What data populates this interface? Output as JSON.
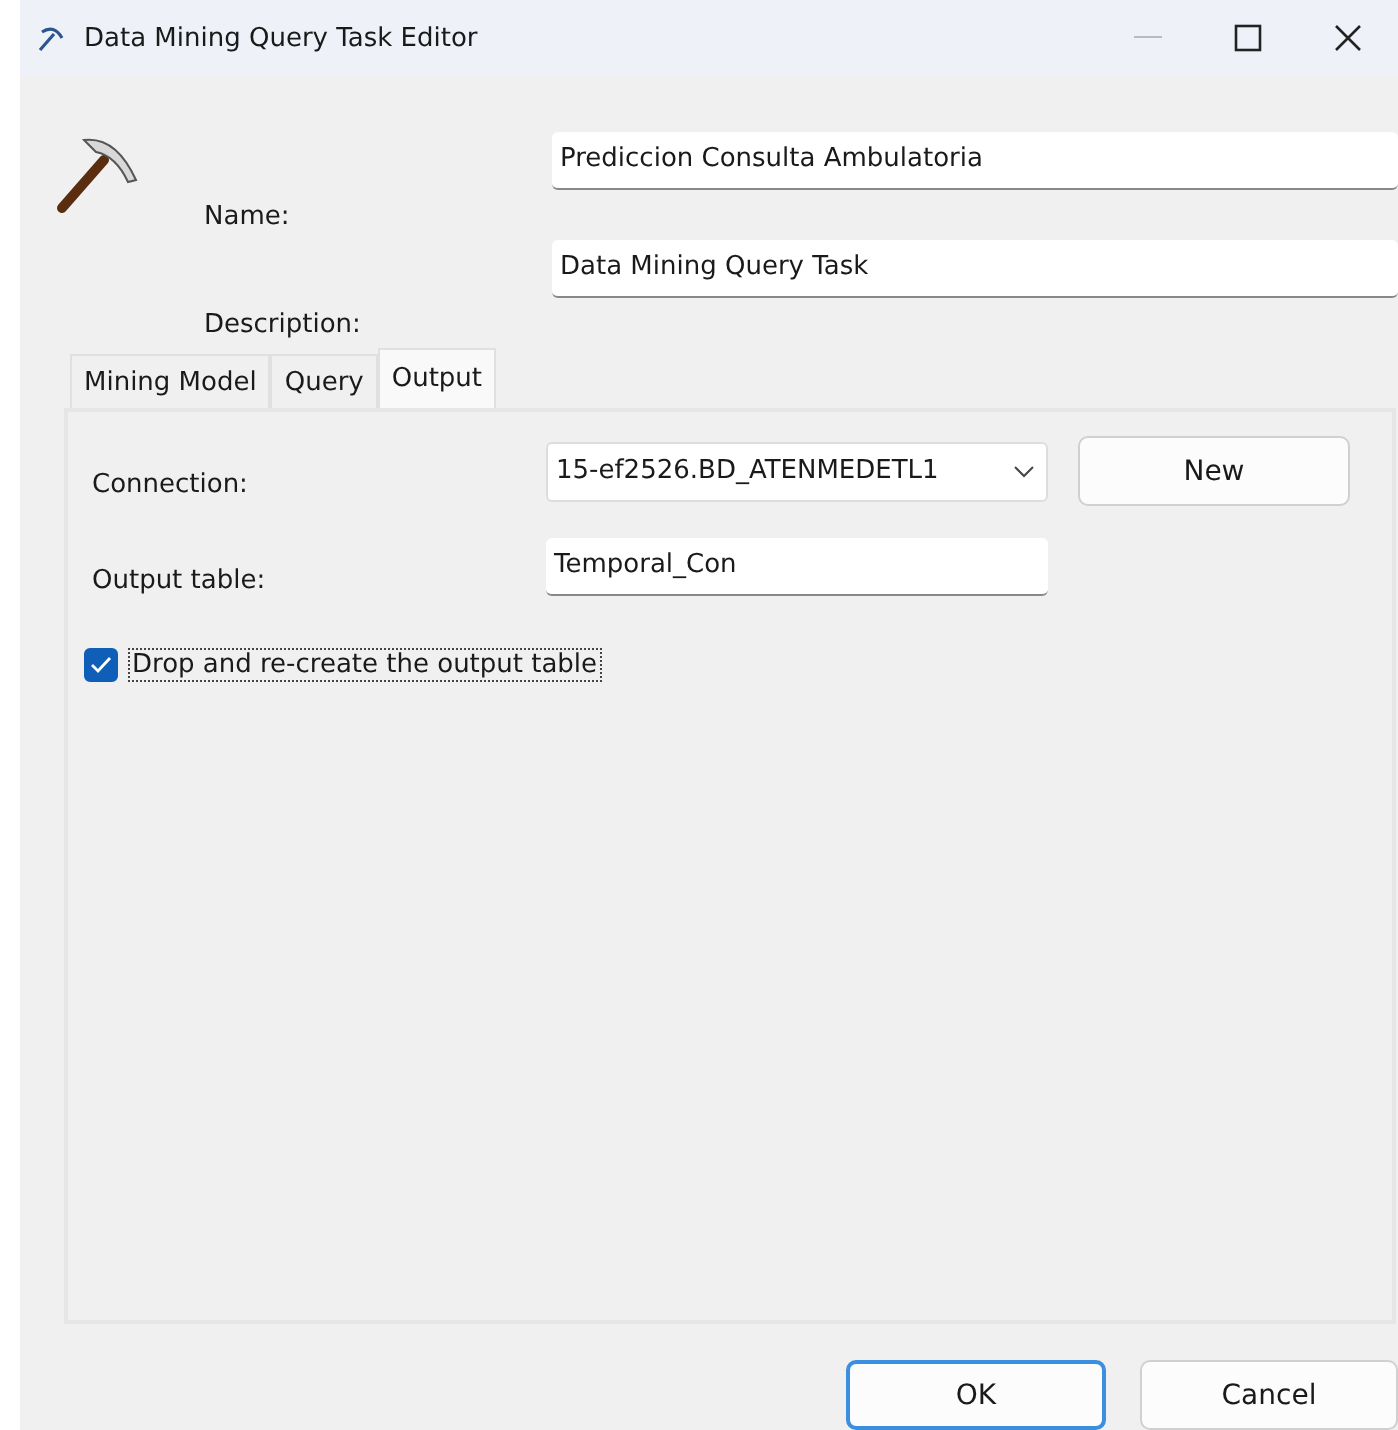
{
  "window": {
    "title": "Data Mining Query Task Editor"
  },
  "fields": [
    {
      "label": "Name:",
      "value": "Prediccion Consulta Ambulatoria"
    },
    {
      "label": "Description:",
      "value": "Data Mining Query Task"
    }
  ],
  "tabs": [
    {
      "label": "Mining Model",
      "selected": false
    },
    {
      "label": "Query",
      "selected": false
    },
    {
      "label": "Output",
      "selected": true
    }
  ],
  "output": {
    "connection": {
      "label": "Connection:",
      "value": "15-ef2526.BD_ATENMEDETL1",
      "button": "New"
    },
    "output_table": {
      "label": "Output table:",
      "value": "Temporal_Con"
    },
    "drop_recreate": {
      "label": "Drop and re-create the output table",
      "checked": true
    }
  },
  "buttons": [
    {
      "label": "OK",
      "kind": "default"
    },
    {
      "label": "Cancel",
      "kind": "normal"
    }
  ]
}
